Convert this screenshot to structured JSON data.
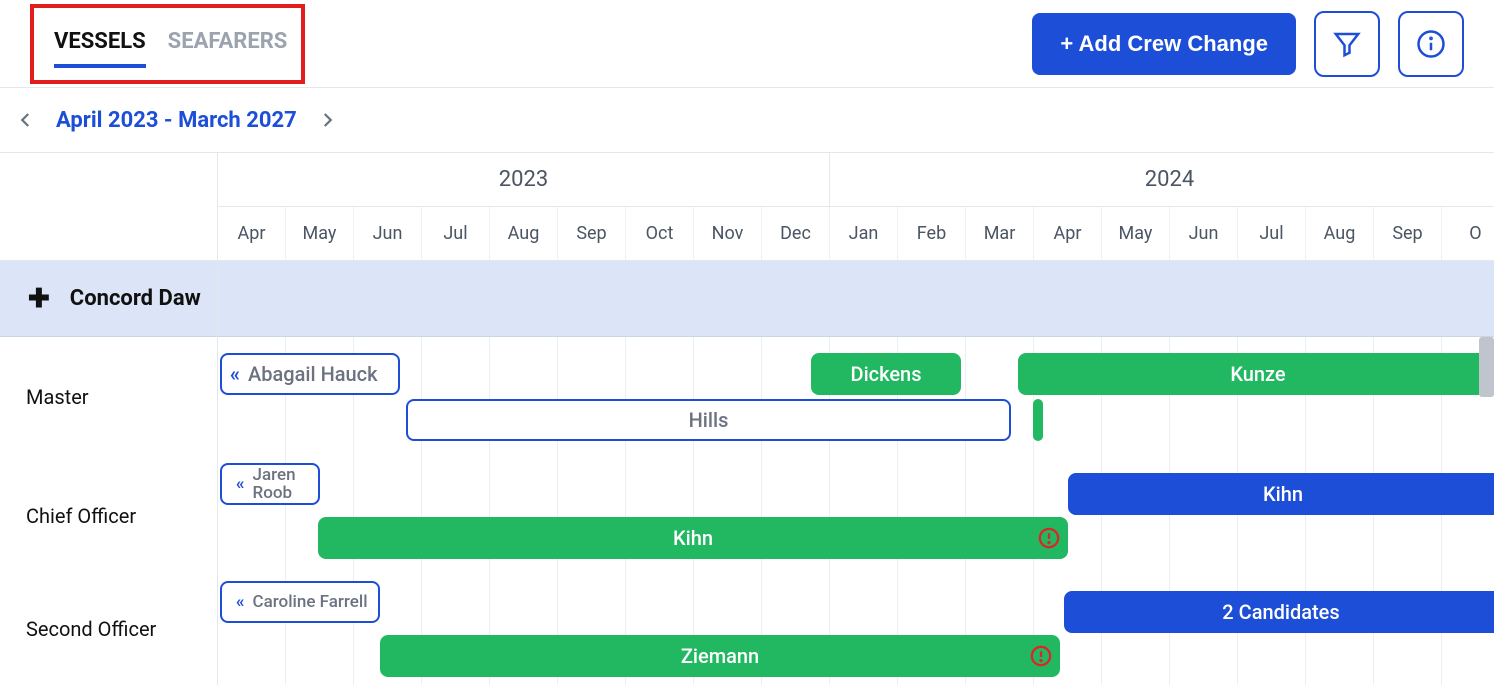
{
  "tabs": {
    "vessels": "VESSELS",
    "seafarers": "SEAFARERS"
  },
  "header": {
    "add_crew": "+ Add Crew Change"
  },
  "dateRange": "April 2023 - March 2027",
  "timeline": {
    "years": [
      {
        "label": "2023",
        "span": 9
      },
      {
        "label": "2024",
        "span": 10
      }
    ],
    "months": [
      "Apr",
      "May",
      "Jun",
      "Jul",
      "Aug",
      "Sep",
      "Oct",
      "Nov",
      "Dec",
      "Jan",
      "Feb",
      "Mar",
      "Apr",
      "May",
      "Jun",
      "Jul",
      "Aug",
      "Sep",
      "O"
    ]
  },
  "vessel": {
    "name": "Concord Daw"
  },
  "roles": {
    "master": "Master",
    "chief": "Chief Officer",
    "second": "Second Officer"
  },
  "bars": {
    "hauck": "Abagail Hauck",
    "dickens": "Dickens",
    "kunze": "Kunze",
    "hills": "Hills",
    "roob": "Jaren Roob",
    "kihn_green": "Kihn",
    "kihn_blue": "Kihn",
    "farrell": "Caroline Farrell",
    "ziemann": "Ziemann",
    "candidates": "2 Candidates"
  }
}
